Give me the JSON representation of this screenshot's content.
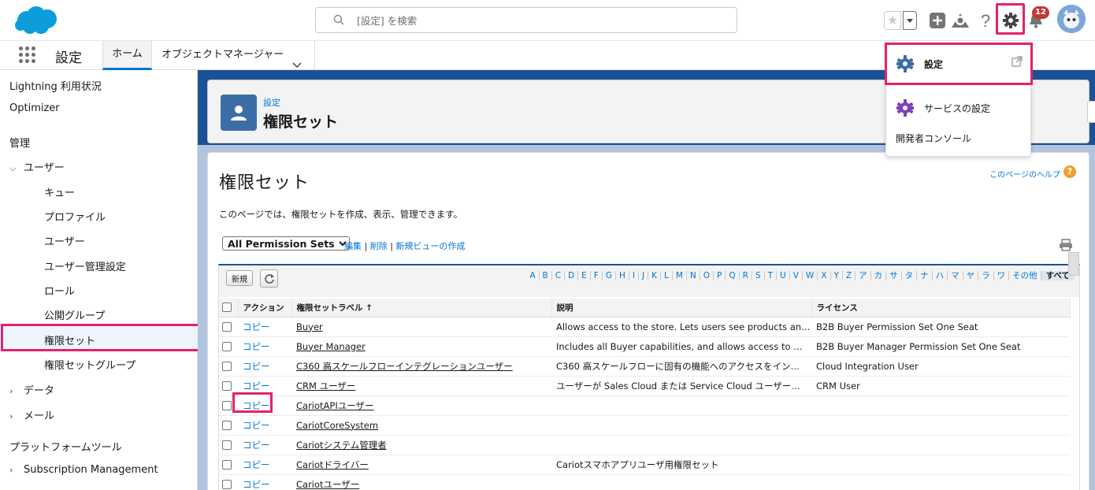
{
  "header": {
    "search_placeholder": "[設定] を検索",
    "notifications_count": "12",
    "favorites_icon": "star-icon",
    "colors": {
      "brand": "#0176d3",
      "highlight": "#e2226e",
      "badge": "#c23934"
    }
  },
  "context_bar": {
    "app_name": "設定",
    "tabs": [
      {
        "label": "ホーム",
        "active": true
      },
      {
        "label": "オブジェクトマネージャー",
        "active": false
      }
    ]
  },
  "sidebar": {
    "items": [
      {
        "label": "Lightning 利用状況"
      },
      {
        "label": "Optimizer"
      }
    ],
    "section_admin": "管理",
    "users_group": {
      "label": "ユーザー",
      "children": [
        "キュー",
        "プロファイル",
        "ユーザー",
        "ユーザー管理設定",
        "ロール",
        "公開グループ",
        "権限セット",
        "権限セットグループ"
      ],
      "selected": "権限セット"
    },
    "data_group": "データ",
    "mail_group": "メール",
    "section_platform": "プラットフォームツール",
    "subscription_group": "Subscription Management"
  },
  "page_header": {
    "breadcrumb": "設定",
    "title": "権限セット"
  },
  "content": {
    "title": "権限セット",
    "description": "このページでは、権限セットを作成、表示、管理できます。",
    "help_link": "このページのヘルプ",
    "view_selected": "All Permission Sets",
    "view_links": {
      "edit": "編集",
      "delete": "削除",
      "new_view": "新規ビューの作成"
    },
    "new_button": "新規",
    "alphabet": [
      "A",
      "B",
      "C",
      "D",
      "E",
      "F",
      "G",
      "H",
      "I",
      "J",
      "K",
      "L",
      "M",
      "N",
      "O",
      "P",
      "Q",
      "R",
      "S",
      "T",
      "U",
      "V",
      "W",
      "X",
      "Y",
      "Z",
      "ア",
      "カ",
      "サ",
      "タ",
      "ナ",
      "ハ",
      "マ",
      "ヤ",
      "ラ",
      "ワ",
      "その他",
      "すべて"
    ],
    "columns": {
      "action": "アクション",
      "label": "権限セットラベル ↑",
      "description": "説明",
      "license": "ライセンス"
    },
    "rows": [
      {
        "action": "コピー",
        "label": "Buyer",
        "description": "Allows access to the store. Lets users see products an…",
        "license": "B2B Buyer Permission Set One Seat"
      },
      {
        "action": "コピー",
        "label": "Buyer Manager",
        "description": "Includes all Buyer capabilities, and allows access to …",
        "license": "B2B Buyer Manager Permission Set One Seat"
      },
      {
        "action": "コピー",
        "label": "C360 高スケールフローインテグレーションユーザー",
        "description": "C360 高スケールフローに固有の機能へのアクセスをイン…",
        "license": "Cloud Integration User"
      },
      {
        "action": "コピー",
        "label": "CRM ユーザー",
        "description": "ユーザーが Sales Cloud または Service Cloud ユーザー…",
        "license": "CRM User"
      },
      {
        "action": "コピー",
        "label": "CariotAPIユーザー",
        "description": "",
        "license": ""
      },
      {
        "action": "コピー",
        "label": "CariotCoreSystem",
        "description": "",
        "license": ""
      },
      {
        "action": "コピー",
        "label": "Cariotシステム管理者",
        "description": "",
        "license": ""
      },
      {
        "action": "コピー",
        "label": "Cariotドライバー",
        "description": "Cariotスマホアプリユーザ用権限セット",
        "license": ""
      },
      {
        "action": "コピー",
        "label": "Cariotユーザー",
        "description": "",
        "license": ""
      }
    ]
  },
  "setup_menu": {
    "items": [
      {
        "label": "設定",
        "icon": "gear-icon"
      },
      {
        "label": "サービスの設定",
        "icon": "service-gear-icon"
      },
      {
        "label": "開発者コンソール"
      }
    ]
  }
}
